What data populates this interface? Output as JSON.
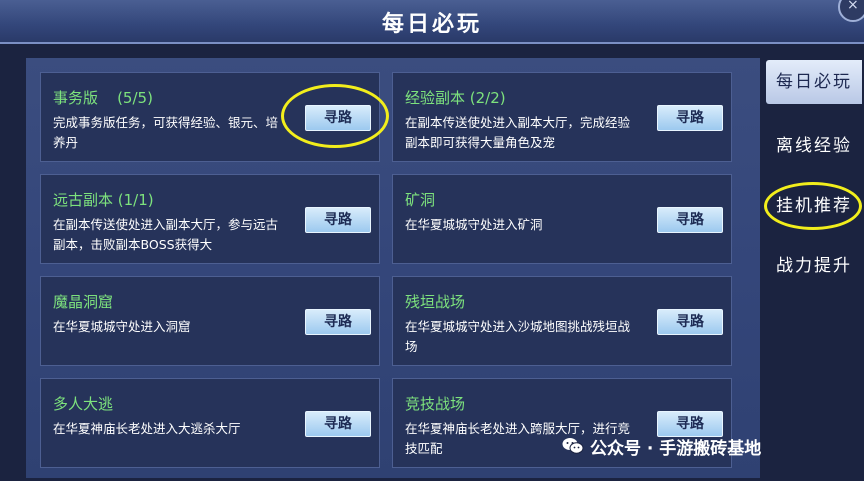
{
  "title": "每日必玩",
  "close_icon": "×",
  "cards": [
    {
      "title": "事务版    (5/5)",
      "desc": "完成事务版任务，可获得经验、银元、培养丹",
      "button": "寻路"
    },
    {
      "title": "经验副本 (2/2)",
      "desc": "在副本传送使处进入副本大厅，完成经验副本即可获得大量角色及宠",
      "button": "寻路"
    },
    {
      "title": "远古副本 (1/1)",
      "desc": "在副本传送使处进入副本大厅，参与远古副本，击败副本BOSS获得大",
      "button": "寻路"
    },
    {
      "title": "矿洞",
      "desc": "在华夏城城守处进入矿洞",
      "button": "寻路"
    },
    {
      "title": "魔晶洞窟",
      "desc": "在华夏城城守处进入洞窟",
      "button": "寻路"
    },
    {
      "title": "残垣战场",
      "desc": "在华夏城城守处进入沙城地图挑战残垣战场",
      "button": "寻路"
    },
    {
      "title": "多人大逃",
      "desc": "在华夏神庙长老处进入大逃杀大厅",
      "button": "寻路"
    },
    {
      "title": "竞技战场",
      "desc": "在华夏神庙长老处进入跨服大厅，进行竞技匹配",
      "button": "寻路"
    }
  ],
  "tabs": [
    "每日必玩",
    "离线经验",
    "挂机推荐",
    "战力提升"
  ],
  "active_tab": "每日必玩",
  "watermark": "公众号 · 手游搬砖基地",
  "colors": {
    "card_title": "#7de27d",
    "highlight": "#f2ee1c",
    "button": "#b8dcf5"
  }
}
